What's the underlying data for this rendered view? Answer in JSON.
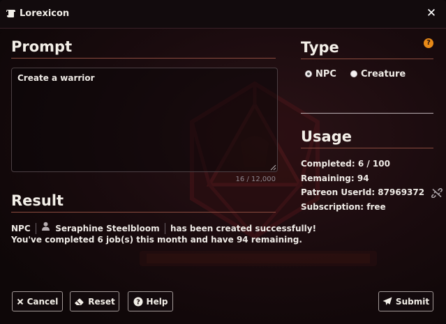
{
  "window": {
    "title": "Lorexicon"
  },
  "prompt": {
    "heading": "Prompt",
    "value": "Create a warrior",
    "char_count": "16 / 12,000"
  },
  "result": {
    "heading": "Result",
    "type_label": "NPC",
    "name": "Seraphine Steelbloom",
    "suffix": "has been created successfully!",
    "summary": "You've completed 6 job(s) this month and have 94 remaining."
  },
  "type": {
    "heading": "Type",
    "help": "?",
    "options": [
      {
        "label": "NPC",
        "checked": true
      },
      {
        "label": "Creature",
        "checked": false
      }
    ]
  },
  "usage": {
    "heading": "Usage",
    "completed": "Completed: 6 / 100",
    "remaining": "Remaining: 94",
    "patreon": "Patreon UserId: 87969372",
    "subscription": "Subscription: free"
  },
  "buttons": {
    "cancel": "Cancel",
    "reset": "Reset",
    "help": "Help",
    "submit": "Submit"
  },
  "icons": {
    "app": "scroll-icon",
    "close": "close-icon",
    "person": "user-icon",
    "unlink": "unlink-icon"
  }
}
